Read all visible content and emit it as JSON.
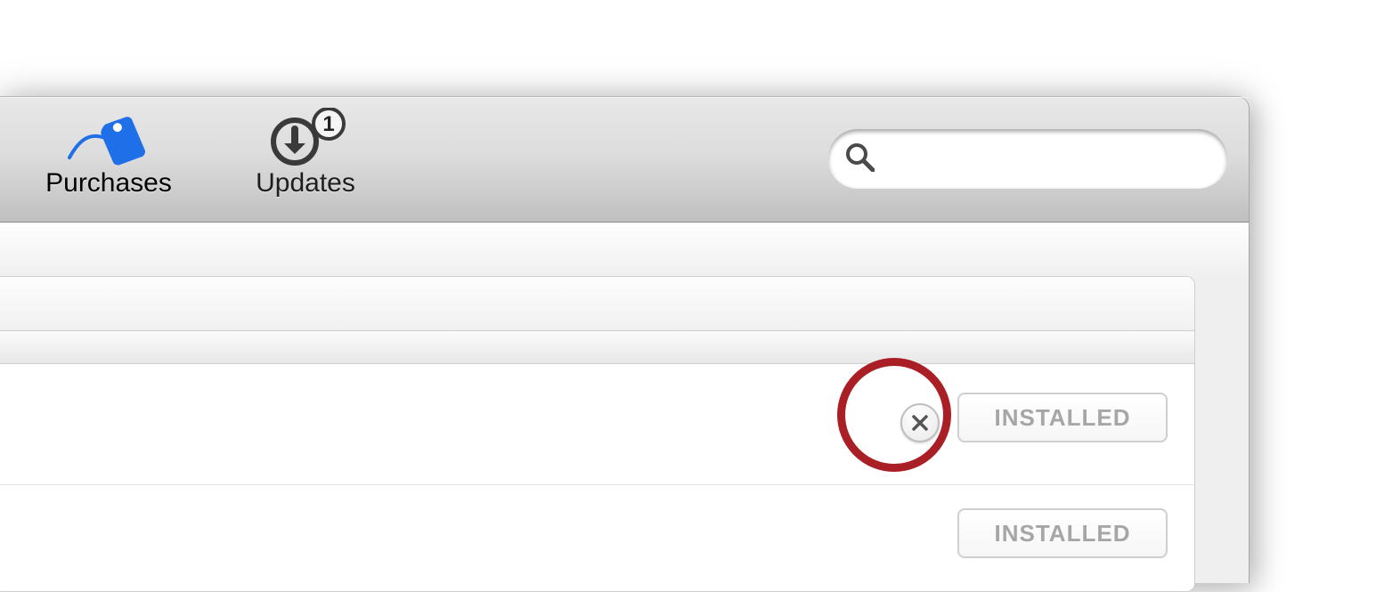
{
  "toolbar": {
    "purchases": {
      "label": "Purchases",
      "active": true
    },
    "updates": {
      "label": "Updates",
      "badge": "1"
    }
  },
  "search": {
    "placeholder": ""
  },
  "list": {
    "rows": [
      {
        "status": "INSTALLED",
        "has_hide_button": true
      },
      {
        "status": "INSTALLED",
        "has_hide_button": false
      }
    ]
  },
  "annotation": {
    "target": "hide-button-row-1"
  },
  "colors": {
    "accent_blue": "#1f6fe8",
    "annotation_red": "#aa1e25",
    "disabled_text": "#a6a6a6"
  }
}
